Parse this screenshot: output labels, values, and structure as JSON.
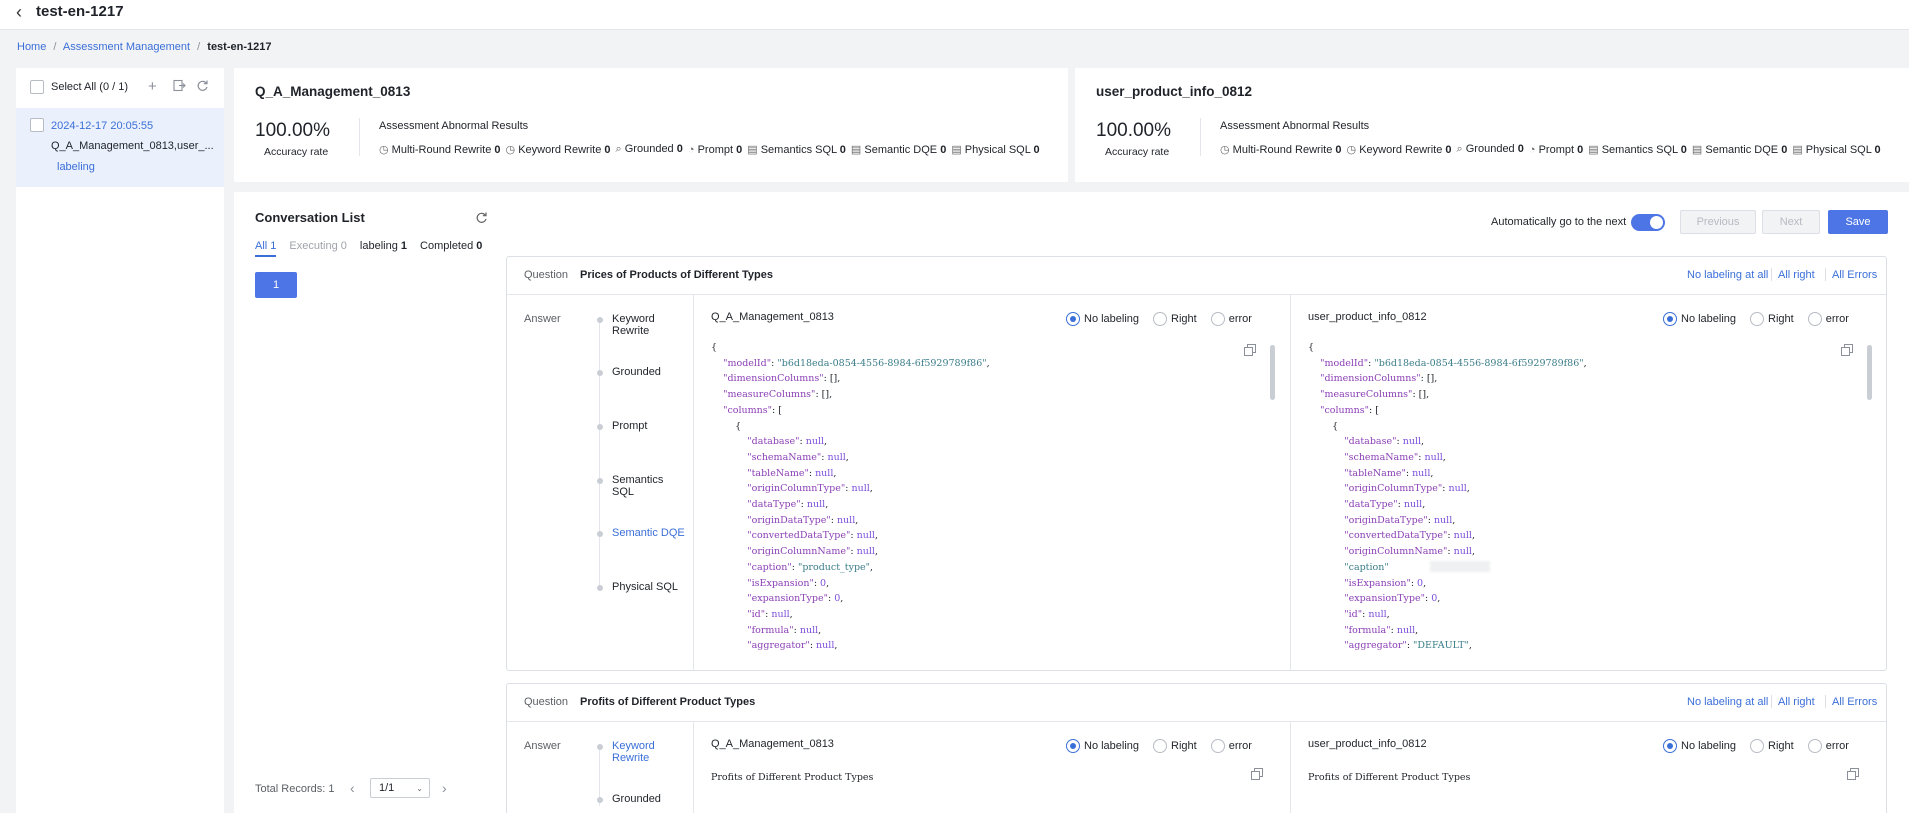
{
  "page": {
    "title": "test-en-1217"
  },
  "breadcrumb": {
    "home": "Home",
    "sep1": "/",
    "assessment": "Assessment Management",
    "sep2": "/",
    "current": "test-en-1217"
  },
  "sidebar": {
    "select_all": "Select All (0 / 1)",
    "item": {
      "date": "2024-12-17 20:05:55",
      "name": "Q_A_Management_0813,user_...",
      "status": "labeling"
    }
  },
  "models": [
    {
      "name": "Q_A_Management_0813",
      "accuracy": "100.00%",
      "accuracy_label": "Accuracy rate",
      "abnormal_title": "Assessment Abnormal Results",
      "stats": [
        {
          "label": "Multi-Round Rewrite",
          "value": "0"
        },
        {
          "label": "Keyword Rewrite",
          "value": "0"
        },
        {
          "label": "Grounded",
          "value": "0"
        },
        {
          "label": "Prompt",
          "value": "0"
        },
        {
          "label": "Semantics SQL",
          "value": "0"
        },
        {
          "label": "Semantic DQE",
          "value": "0"
        },
        {
          "label": "Physical SQL",
          "value": "0"
        }
      ]
    },
    {
      "name": "user_product_info_0812",
      "accuracy": "100.00%",
      "accuracy_label": "Accuracy rate",
      "abnormal_title": "Assessment Abnormal Results",
      "stats": [
        {
          "label": "Multi-Round Rewrite",
          "value": "0"
        },
        {
          "label": "Keyword Rewrite",
          "value": "0"
        },
        {
          "label": "Grounded",
          "value": "0"
        },
        {
          "label": "Prompt",
          "value": "0"
        },
        {
          "label": "Semantics SQL",
          "value": "0"
        },
        {
          "label": "Semantic DQE",
          "value": "0"
        },
        {
          "label": "Physical SQL",
          "value": "0"
        }
      ]
    }
  ],
  "conversation": {
    "title": "Conversation List",
    "tabs": [
      {
        "label": "All",
        "count": "1"
      },
      {
        "label": "Executing",
        "count": "0"
      },
      {
        "label": "labeling",
        "count": "1"
      },
      {
        "label": "Completed",
        "count": "0"
      }
    ],
    "item_number": "1",
    "total": "Total Records: 1",
    "page_select": "1/1"
  },
  "toolbar": {
    "auto_next": "Automatically go to the next",
    "auto_next_on": true,
    "previous": "Previous",
    "next": "Next",
    "save": "Save"
  },
  "labels": {
    "question": "Question",
    "answer": "Answer",
    "no_labeling_at_all": "No labeling at all",
    "all_right": "All right",
    "all_errors": "All Errors",
    "no_labeling": "No labeling",
    "right": "Right",
    "error": "error"
  },
  "steps": [
    "Keyword Rewrite",
    "Grounded",
    "Prompt",
    "Semantics SQL",
    "Semantic DQE",
    "Physical SQL"
  ],
  "questions": [
    {
      "text": "Prices of Products of Different Types",
      "active_step": "Semantic DQE",
      "left_model": "Q_A_Management_0813",
      "right_model": "user_product_info_0812"
    },
    {
      "text": "Profits of Different Product Types",
      "active_step": "Keyword Rewrite",
      "left_model": "Q_A_Management_0813",
      "right_model": "user_product_info_0812",
      "answer_text": "Profits of Different Product Types",
      "steps_shown": [
        "Keyword Rewrite",
        "Grounded"
      ]
    }
  ],
  "code_left": [
    "{",
    "    \"modelId\": \"b6d18eda-0854-4556-8984-6f5929789f86\",",
    "    \"dimensionColumns\": [],",
    "    \"measureColumns\": [],",
    "    \"columns\": [",
    "        {",
    "            \"database\": null,",
    "            \"schemaName\": null,",
    "            \"tableName\": null,",
    "            \"originColumnType\": null,",
    "            \"dataType\": null,",
    "            \"originDataType\": null,",
    "            \"convertedDataType\": null,",
    "            \"originColumnName\": null,",
    "            \"caption\": \"product_type\",",
    "            \"isExpansion\": 0,",
    "            \"expansionType\": 0,",
    "            \"id\": null,",
    "            \"formula\": null,",
    "            \"aggregator\": null,"
  ],
  "code_right": [
    "{",
    "    \"modelId\": \"b6d18eda-0854-4556-8984-6f5929789f86\",",
    "    \"dimensionColumns\": [],",
    "    \"measureColumns\": [],",
    "    \"columns\": [",
    "        {",
    "            \"database\": null,",
    "            \"schemaName\": null,",
    "            \"tableName\": null,",
    "            \"originColumnType\": null,",
    "            \"dataType\": null,",
    "            \"originDataType\": null,",
    "            \"convertedDataType\": null,",
    "            \"originColumnName\": null,",
    "            \"caption\"",
    "            \"isExpansion\": 0,",
    "            \"expansionType\": 0,",
    "            \"id\": null,",
    "            \"formula\": null,",
    "            \"aggregator\": \"DEFAULT\","
  ]
}
